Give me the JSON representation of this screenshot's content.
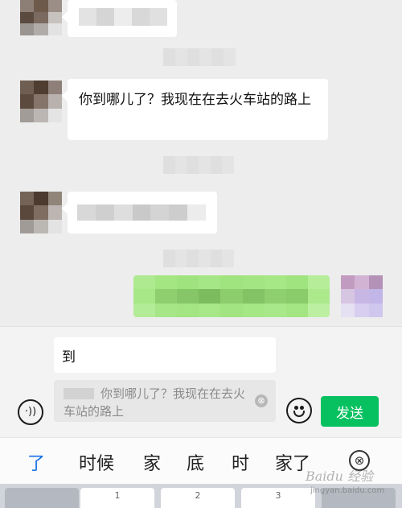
{
  "chat": {
    "messages": [
      {
        "from": "contact",
        "text": "你到哪儿了？我现在在去火车站的路上"
      }
    ]
  },
  "input": {
    "value": "到",
    "quote_text": "你到哪儿了？我现在在去火车站的路上",
    "quote_close_icon": "⊗",
    "voice_icon": "·))",
    "send_label": "发送"
  },
  "candidates": {
    "items": [
      "了",
      "时候",
      "家",
      "底",
      "时",
      "家了"
    ],
    "close_icon": "⊗"
  },
  "keyboard": {
    "key_hints": [
      "1",
      "2",
      "3"
    ]
  },
  "watermark": {
    "brand": "Baidu 经验",
    "url": "jingyan.baidu.com"
  },
  "colors": {
    "accent": "#07c160",
    "candidate_highlight": "#1a73e8",
    "outgoing_bubble": "#95ec69"
  }
}
